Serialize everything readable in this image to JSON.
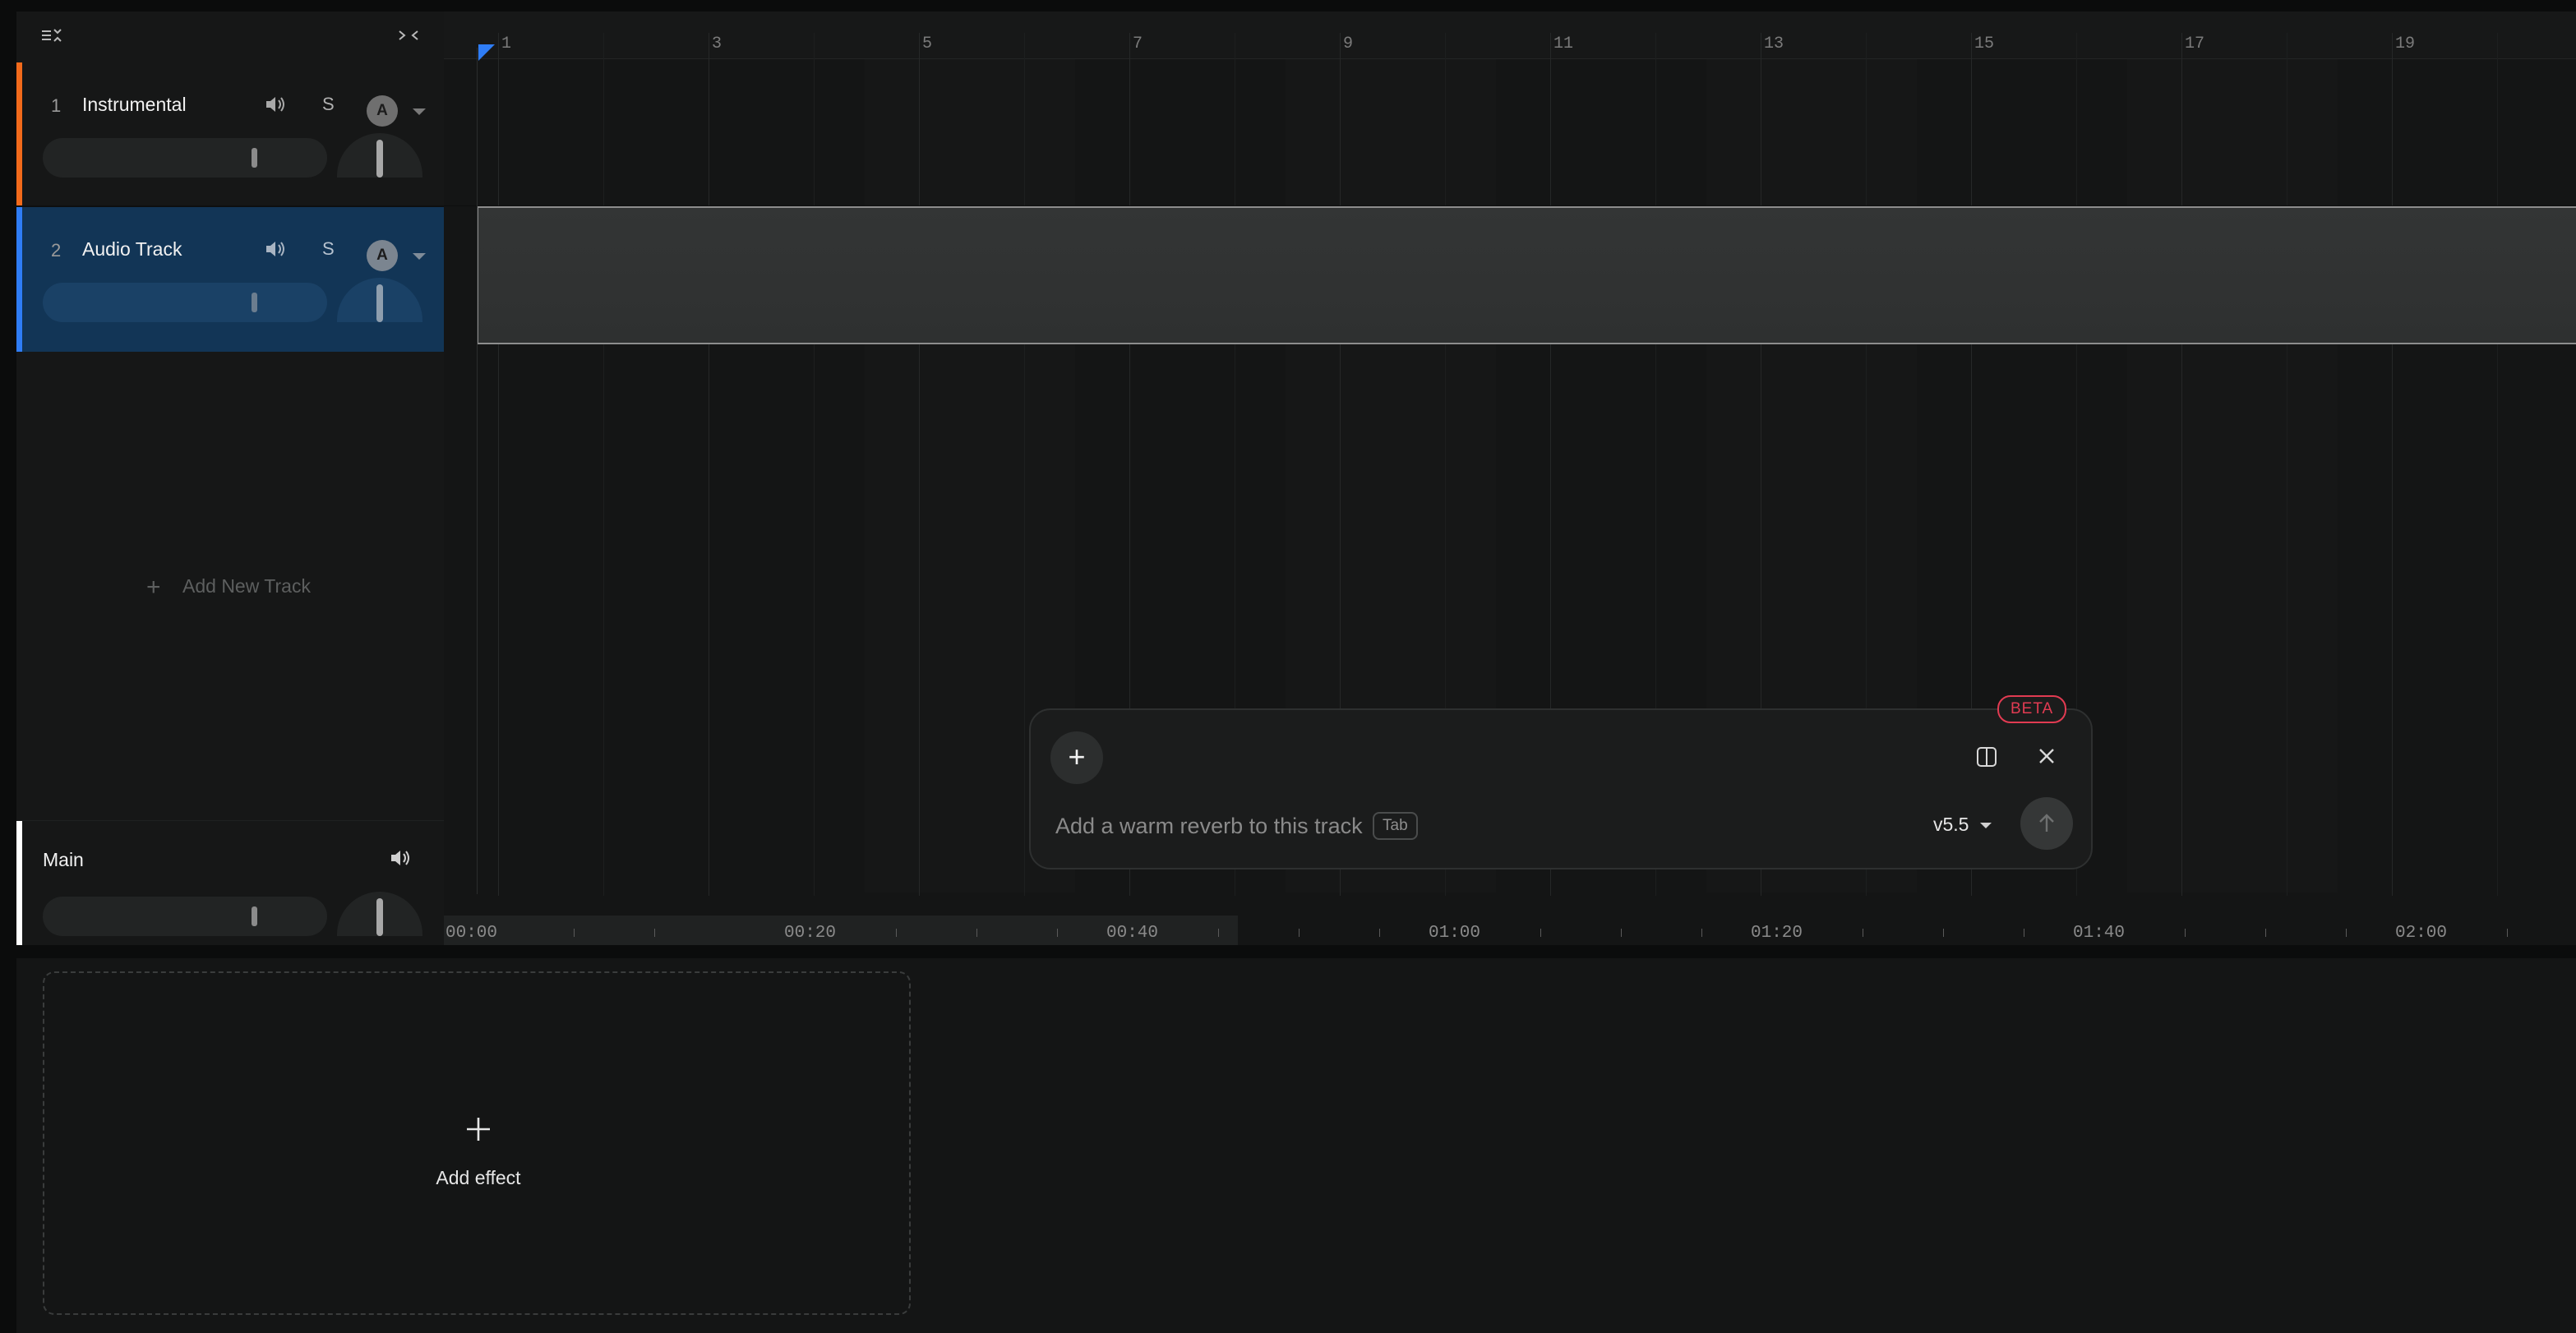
{
  "header": {
    "toolbar_icons": [
      "collapse-list-icon",
      "collapse-panel-icon"
    ]
  },
  "tracks": [
    {
      "number": "1",
      "name": "Instrumental",
      "solo": "S",
      "automation": "A",
      "color": "#f26a1b",
      "selected": false
    },
    {
      "number": "2",
      "name": "Audio Track",
      "solo": "S",
      "automation": "A",
      "color": "#2f7df6",
      "selected": true
    }
  ],
  "add_track_label": "Add New Track",
  "main_track": {
    "name": "Main"
  },
  "ruler": {
    "bar_labels": [
      "1",
      "3",
      "5",
      "7",
      "9",
      "11",
      "13",
      "15",
      "17",
      "19"
    ]
  },
  "time_ruler": {
    "labels": [
      "00:00",
      "00:20",
      "00:40",
      "01:00",
      "01:20",
      "01:40",
      "02:00"
    ]
  },
  "assistant": {
    "beta_label": "BETA",
    "placeholder": "Add a warm reverb to this track",
    "tab_hint": "Tab",
    "model_version": "v5.5"
  },
  "effects": {
    "add_effect_label": "Add effect"
  },
  "colors": {
    "accent_blue": "#2f7df6",
    "instrumental_orange": "#f26a1b",
    "beta_red": "#e23b52",
    "selected_track_bg": "#123556"
  }
}
